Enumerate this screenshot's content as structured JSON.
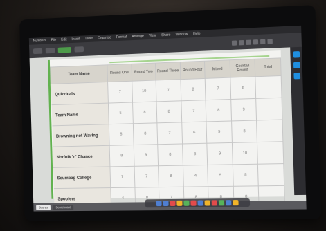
{
  "scene": {
    "description_color_bg": "#1b1816"
  },
  "app": {
    "menu_items": [
      "Numbers",
      "File",
      "Edit",
      "Insert",
      "Table",
      "Organise",
      "Format",
      "Arrange",
      "View",
      "Share",
      "Window",
      "Help"
    ]
  },
  "table": {
    "headers": [
      "Team Name",
      "Round One",
      "Round Two",
      "Round Three",
      "Round Four",
      "Mixed",
      "Cocktail Round",
      "Total"
    ],
    "rows": [
      {
        "team": "Quizzicals",
        "scores": [
          "7",
          "10",
          "7",
          "8",
          "7",
          "8",
          ""
        ]
      },
      {
        "team": "Team Name",
        "scores": [
          "5",
          "8",
          "8",
          "7",
          "8",
          "9",
          ""
        ]
      },
      {
        "team": "Drowning not Waving",
        "scores": [
          "5",
          "8",
          "7",
          "6",
          "9",
          "8",
          ""
        ]
      },
      {
        "team": "Norfolk 'n' Chance",
        "scores": [
          "8",
          "9",
          "8",
          "8",
          "9",
          "10",
          ""
        ]
      },
      {
        "team": "Scumbag College",
        "scores": [
          "7",
          "7",
          "8",
          "4",
          "5",
          "8",
          ""
        ]
      },
      {
        "team": "Spoofers",
        "scores": [
          "4",
          "8",
          "7",
          "8",
          "8",
          "8",
          ""
        ]
      }
    ]
  },
  "tabs": {
    "sheet1": "Scores",
    "sheet2": "Scoreboard"
  },
  "colors": {
    "accent": "#62b24f",
    "header_bg": "#d7d4cc"
  }
}
